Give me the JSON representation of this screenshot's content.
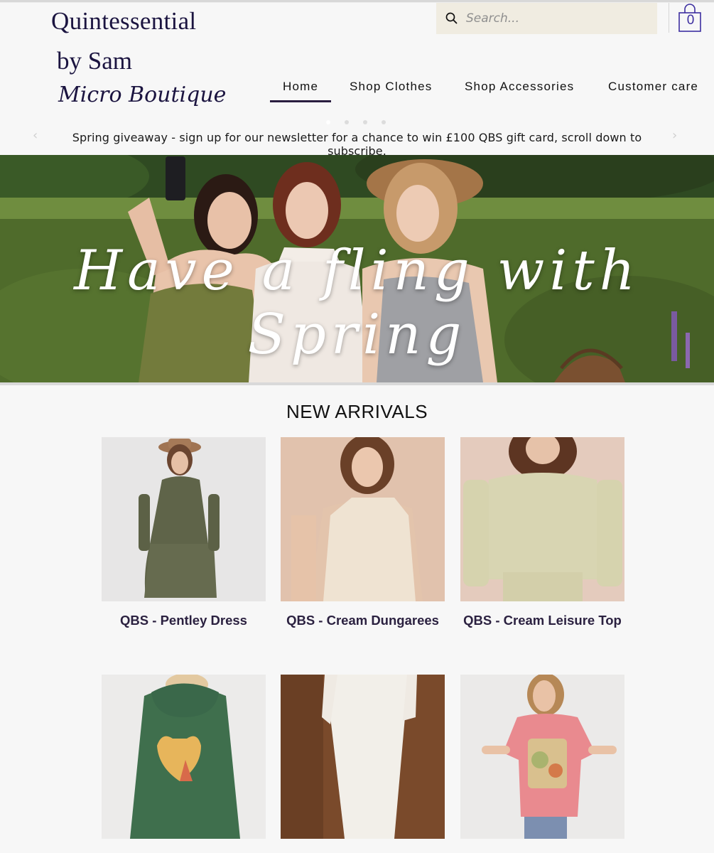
{
  "brand": {
    "line1": "Quintessential",
    "line2": "by Sam",
    "line3": "Micro Boutique"
  },
  "search": {
    "placeholder": "Search..."
  },
  "cart": {
    "count": "0"
  },
  "nav": {
    "items": [
      {
        "label": "Home",
        "active": true
      },
      {
        "label": "Shop Clothes"
      },
      {
        "label": "Shop Accessories"
      },
      {
        "label": "Customer care"
      }
    ]
  },
  "announcement": {
    "text": "Spring giveaway - sign up for our newsletter for a chance to win £100 QBS gift card, scroll down to subscribe.",
    "slides": 4,
    "active_slide": 1
  },
  "hero": {
    "caption": "Have a fling with Spring"
  },
  "section": {
    "title": "NEW ARRIVALS"
  },
  "products": [
    {
      "name": "QBS - Pentley Dress",
      "color": "#5f6449"
    },
    {
      "name": "QBS - Cream Dungarees",
      "color": "#efe3d2"
    },
    {
      "name": "QBS - Cream Leisure Top",
      "color": "#d8d5b2"
    },
    {
      "name": "",
      "color": "#3f6f4d"
    },
    {
      "name": "",
      "color": "#f2efe9"
    },
    {
      "name": "",
      "color": "#e98a8f"
    }
  ],
  "colors": {
    "brand": "#1b1440",
    "search_bg": "#f0ece1",
    "cart_accent": "#3d2fa0",
    "nav_underline": "#2a1d40",
    "product_text": "#2b2140"
  },
  "icons": [
    "search-icon",
    "shopping-bag-icon",
    "chevron-left-icon",
    "chevron-right-icon"
  ]
}
